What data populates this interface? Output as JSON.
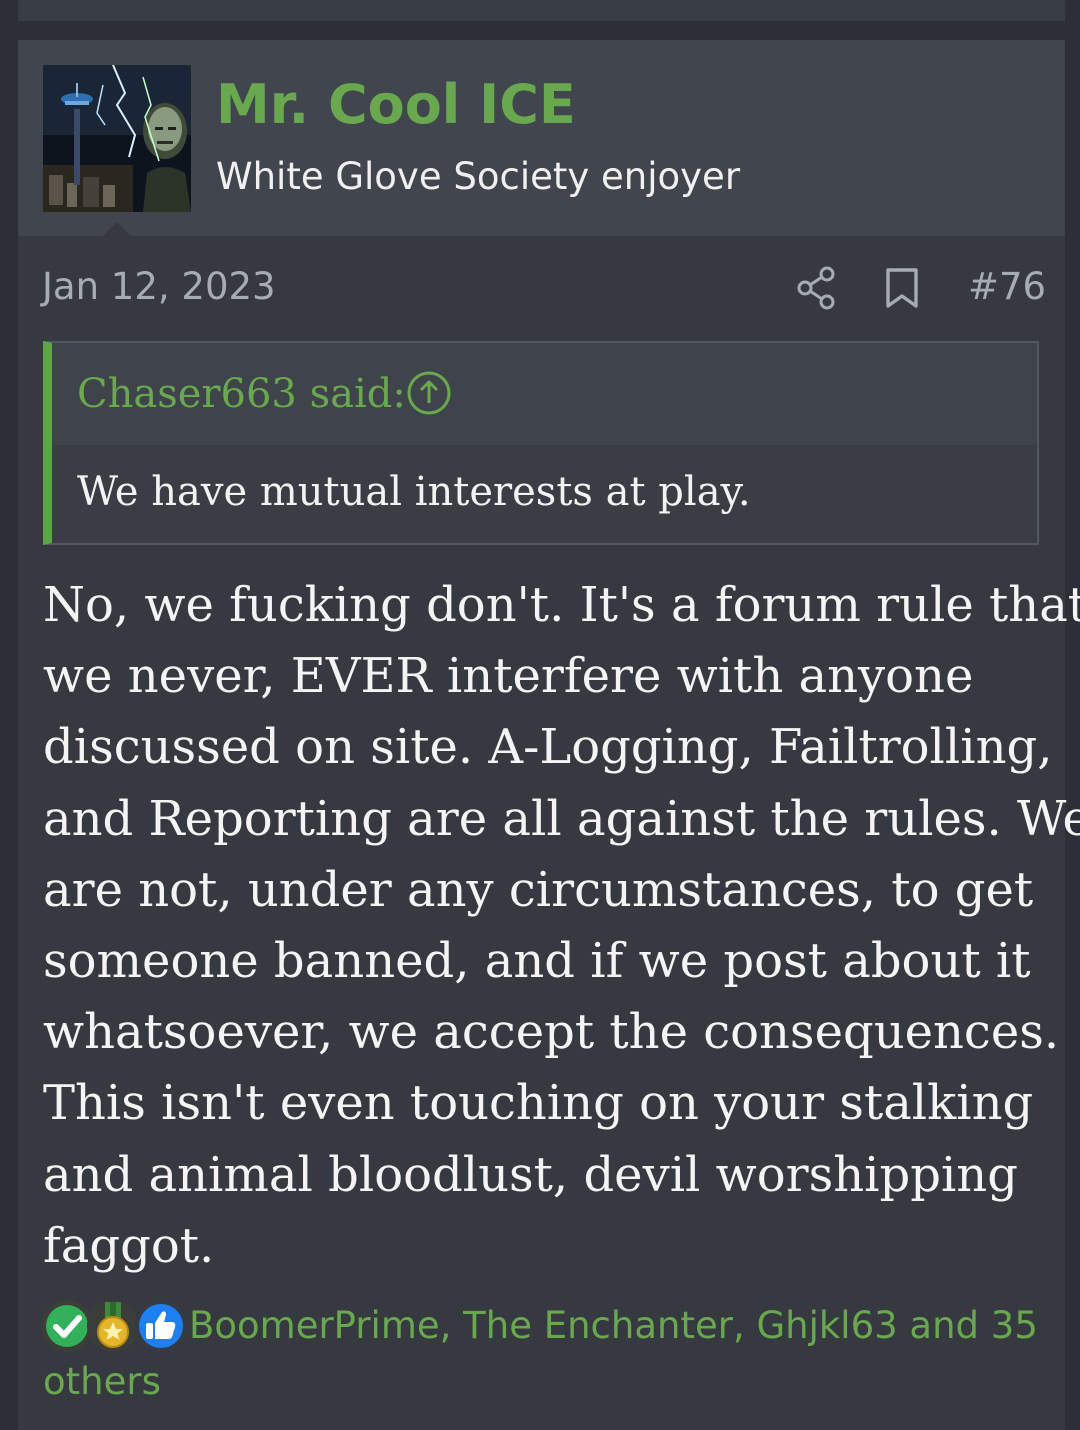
{
  "post": {
    "author": {
      "name": "Mr. Cool ICE",
      "title": "White Glove Society enjoyer",
      "avatar_icon": "avatar-image"
    },
    "date": "Jan 12, 2023",
    "number": "#76",
    "actions": {
      "share_icon": "share-icon",
      "bookmark_icon": "bookmark-icon"
    },
    "quote": {
      "author_line": "Chaser663 said:",
      "jump_icon": "arrow-up-circle-icon",
      "text": "We have mutual interests at play.",
      "accent_color": "#5aa843"
    },
    "body_lines": [
      "No, we fucking don't. It's a forum rule that",
      "we never, EVER interfere with anyone",
      "discussed on site. A-Logging, Failtrolling,",
      "and Reporting are all against the rules. We",
      "are not, under any circumstances, to get",
      "someone banned, and if we post about it",
      "whatsoever, we accept the consequences.",
      "This isn't even touching on your stalking",
      "and animal bloodlust, devil worshipping",
      "faggot."
    ],
    "reactions": {
      "icons": [
        "checkmark-icon",
        "medal-icon",
        "thumbs-up-icon"
      ],
      "users_text": "BoomerPrime, The Enchanter, Ghjkl63 and 35 others"
    }
  },
  "colors": {
    "page_background": "#2c2f36",
    "post_background": "#363940",
    "header_background": "#41454d",
    "accent_green": "#6aa84f",
    "muted_text": "#a7abb2"
  }
}
